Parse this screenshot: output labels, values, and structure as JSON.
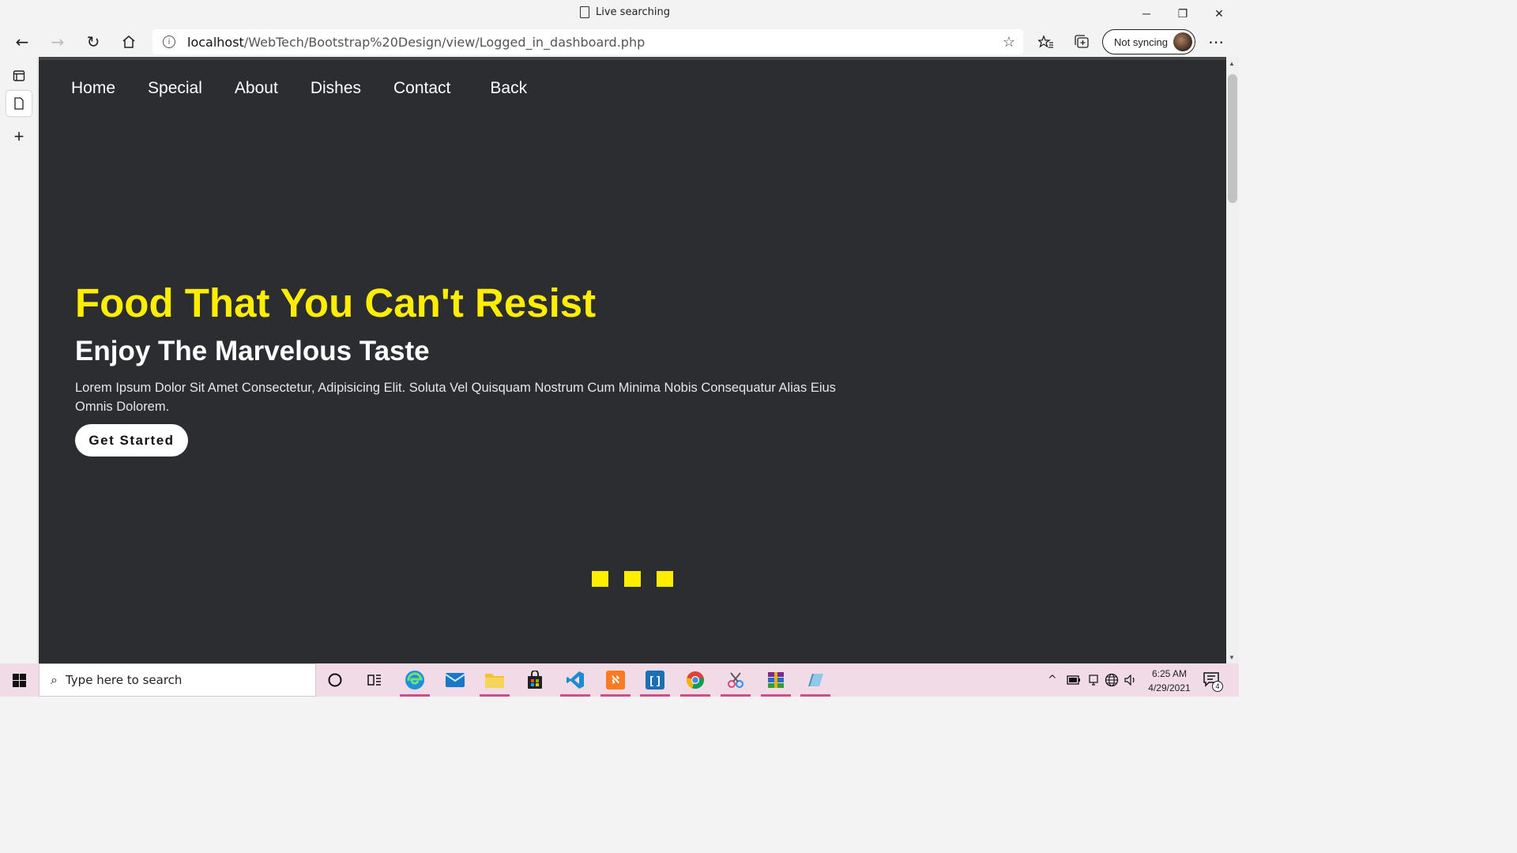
{
  "browser": {
    "tab_title": "Live searching",
    "url_host": "localhost",
    "url_path": "/WebTech/Bootstrap%20Design/view/Logged_in_dashboard.php",
    "sync_label": "Not syncing",
    "controls": {
      "minimize": "─",
      "restore": "❐",
      "close": "✕"
    }
  },
  "nav": {
    "items": [
      "Home",
      "Special",
      "About",
      "Dishes",
      "Contact",
      "Back"
    ]
  },
  "hero": {
    "title": "Food That You Can't Resist",
    "subtitle": "Enjoy The Marvelous Taste",
    "text": "Lorem Ipsum Dolor Sit Amet Consectetur, Adipisicing Elit. Soluta Vel Quisquam Nostrum Cum Minima Nobis Consequatur Alias Eius Omnis Dolorem.",
    "button": "Get Started"
  },
  "colors": {
    "page_bg": "#2b2d31",
    "accent_yellow": "#ffee00",
    "taskbar_bg": "#f1dbe6"
  },
  "taskbar": {
    "search_placeholder": "Type here to search",
    "apps": [
      "cortana-icon",
      "task-view-icon",
      "edge-icon",
      "mail-icon",
      "file-explorer-icon",
      "store-icon",
      "vscode-icon",
      "xampp-icon",
      "brackets-icon",
      "chrome-icon",
      "snip-icon",
      "winrar-icon",
      "notepad-icon"
    ],
    "time": "6:25 AM",
    "date": "4/29/2021",
    "notification_count": "4"
  }
}
